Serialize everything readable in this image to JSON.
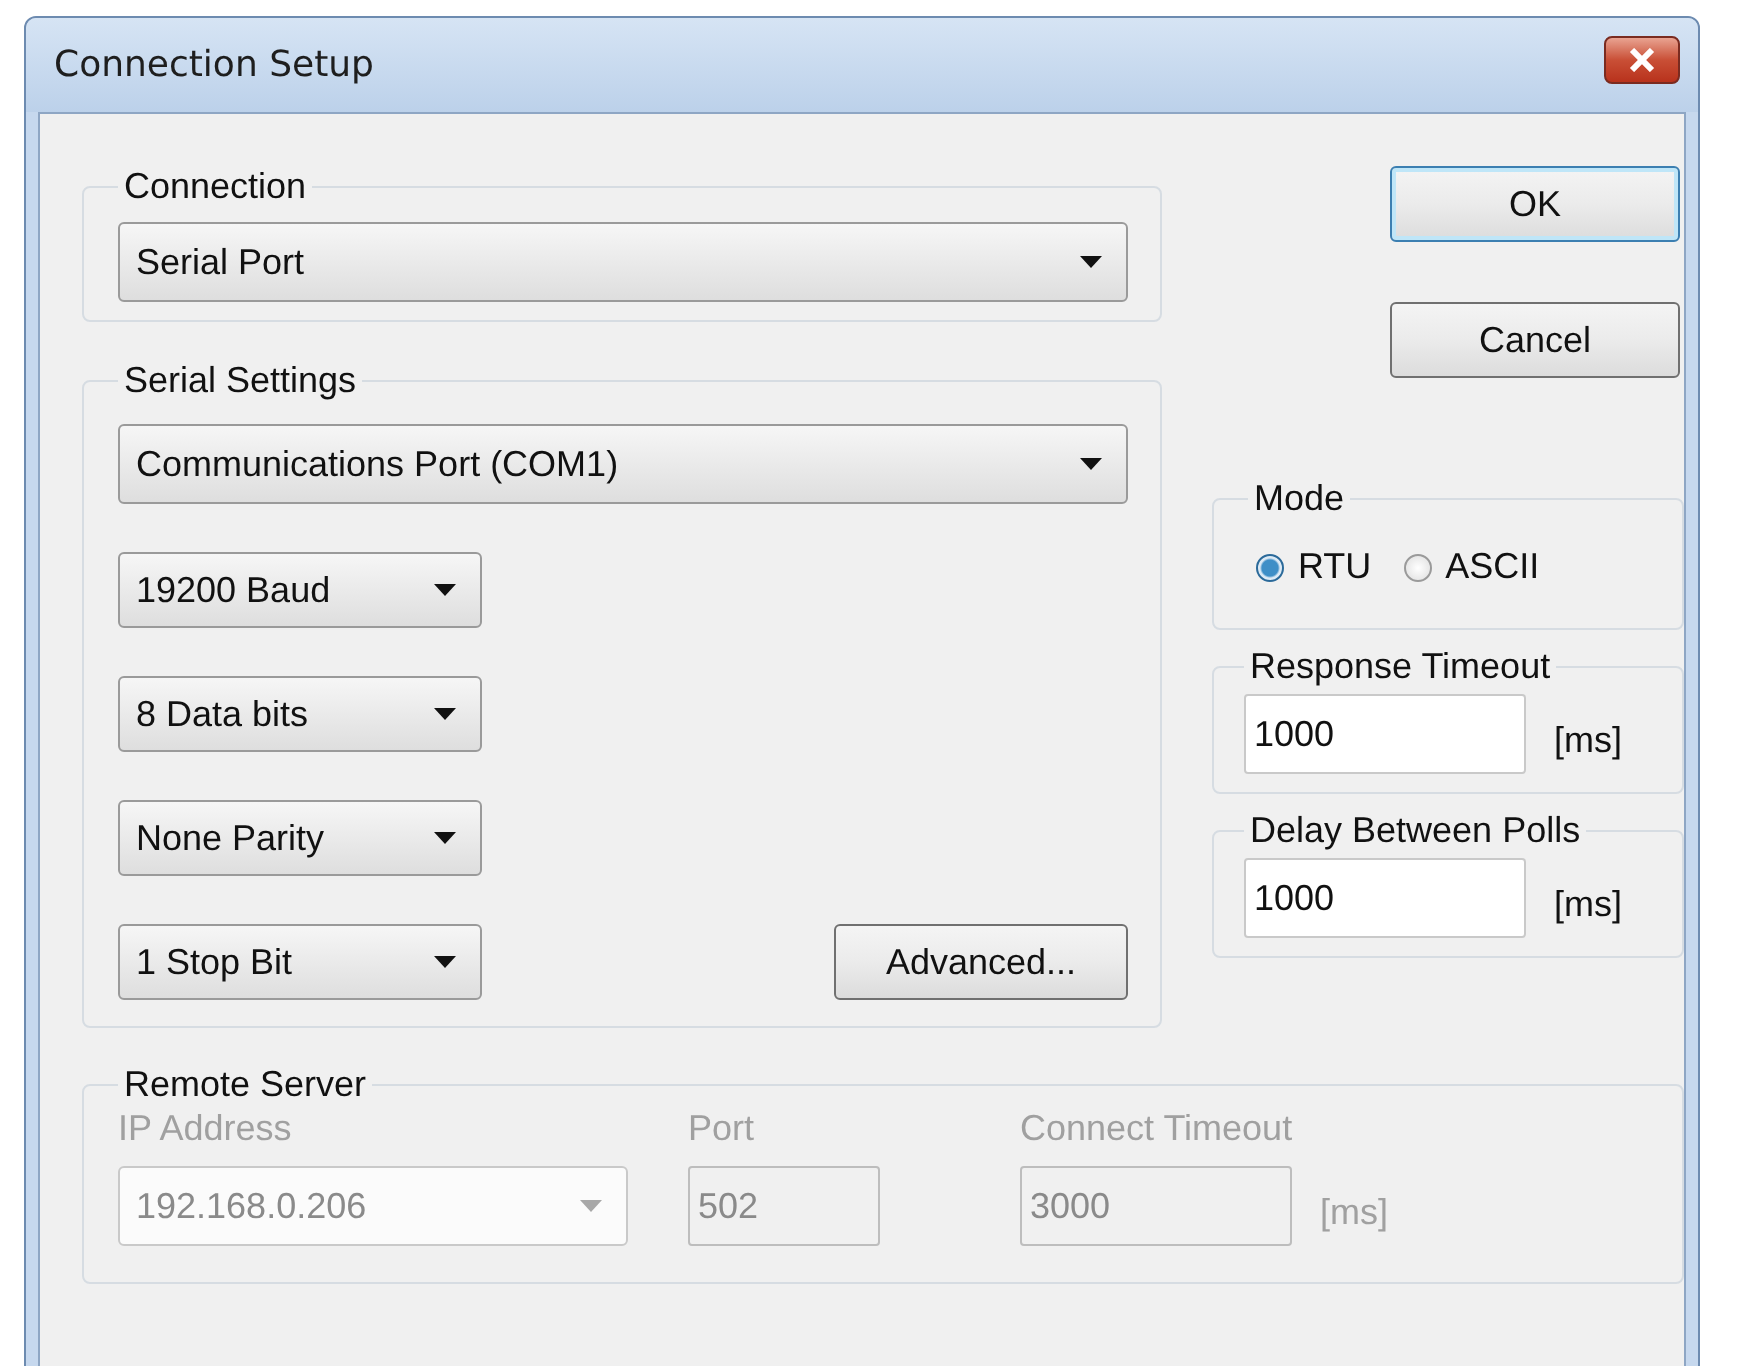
{
  "window": {
    "title": "Connection Setup"
  },
  "connection": {
    "label": "Connection",
    "value": "Serial Port"
  },
  "serial_settings": {
    "label": "Serial Settings",
    "port": "Communications Port (COM1)",
    "options": [
      "19200 Baud",
      "8 Data bits",
      "None Parity",
      "1 Stop Bit"
    ],
    "advanced_button": "Advanced..."
  },
  "buttons": [
    {
      "label": "OK",
      "default": true
    },
    {
      "label": "Cancel",
      "default": false
    }
  ],
  "mode": {
    "label": "Mode",
    "options": [
      {
        "label": "RTU",
        "selected": true
      },
      {
        "label": "ASCII",
        "selected": false
      }
    ]
  },
  "response_timeout": {
    "label": "Response Timeout",
    "value": "1000",
    "unit": "[ms]"
  },
  "delay_between_polls": {
    "label": "Delay Between Polls",
    "value": "1000",
    "unit": "[ms]"
  },
  "remote_server": {
    "label": "Remote Server",
    "disabled": true,
    "fields": [
      {
        "label": "IP Address",
        "value": "192.168.0.206",
        "kind": "combo"
      },
      {
        "label": "Port",
        "value": "502",
        "kind": "text"
      },
      {
        "label": "Connect Timeout",
        "value": "3000",
        "kind": "text",
        "unit": "[ms]"
      }
    ]
  }
}
